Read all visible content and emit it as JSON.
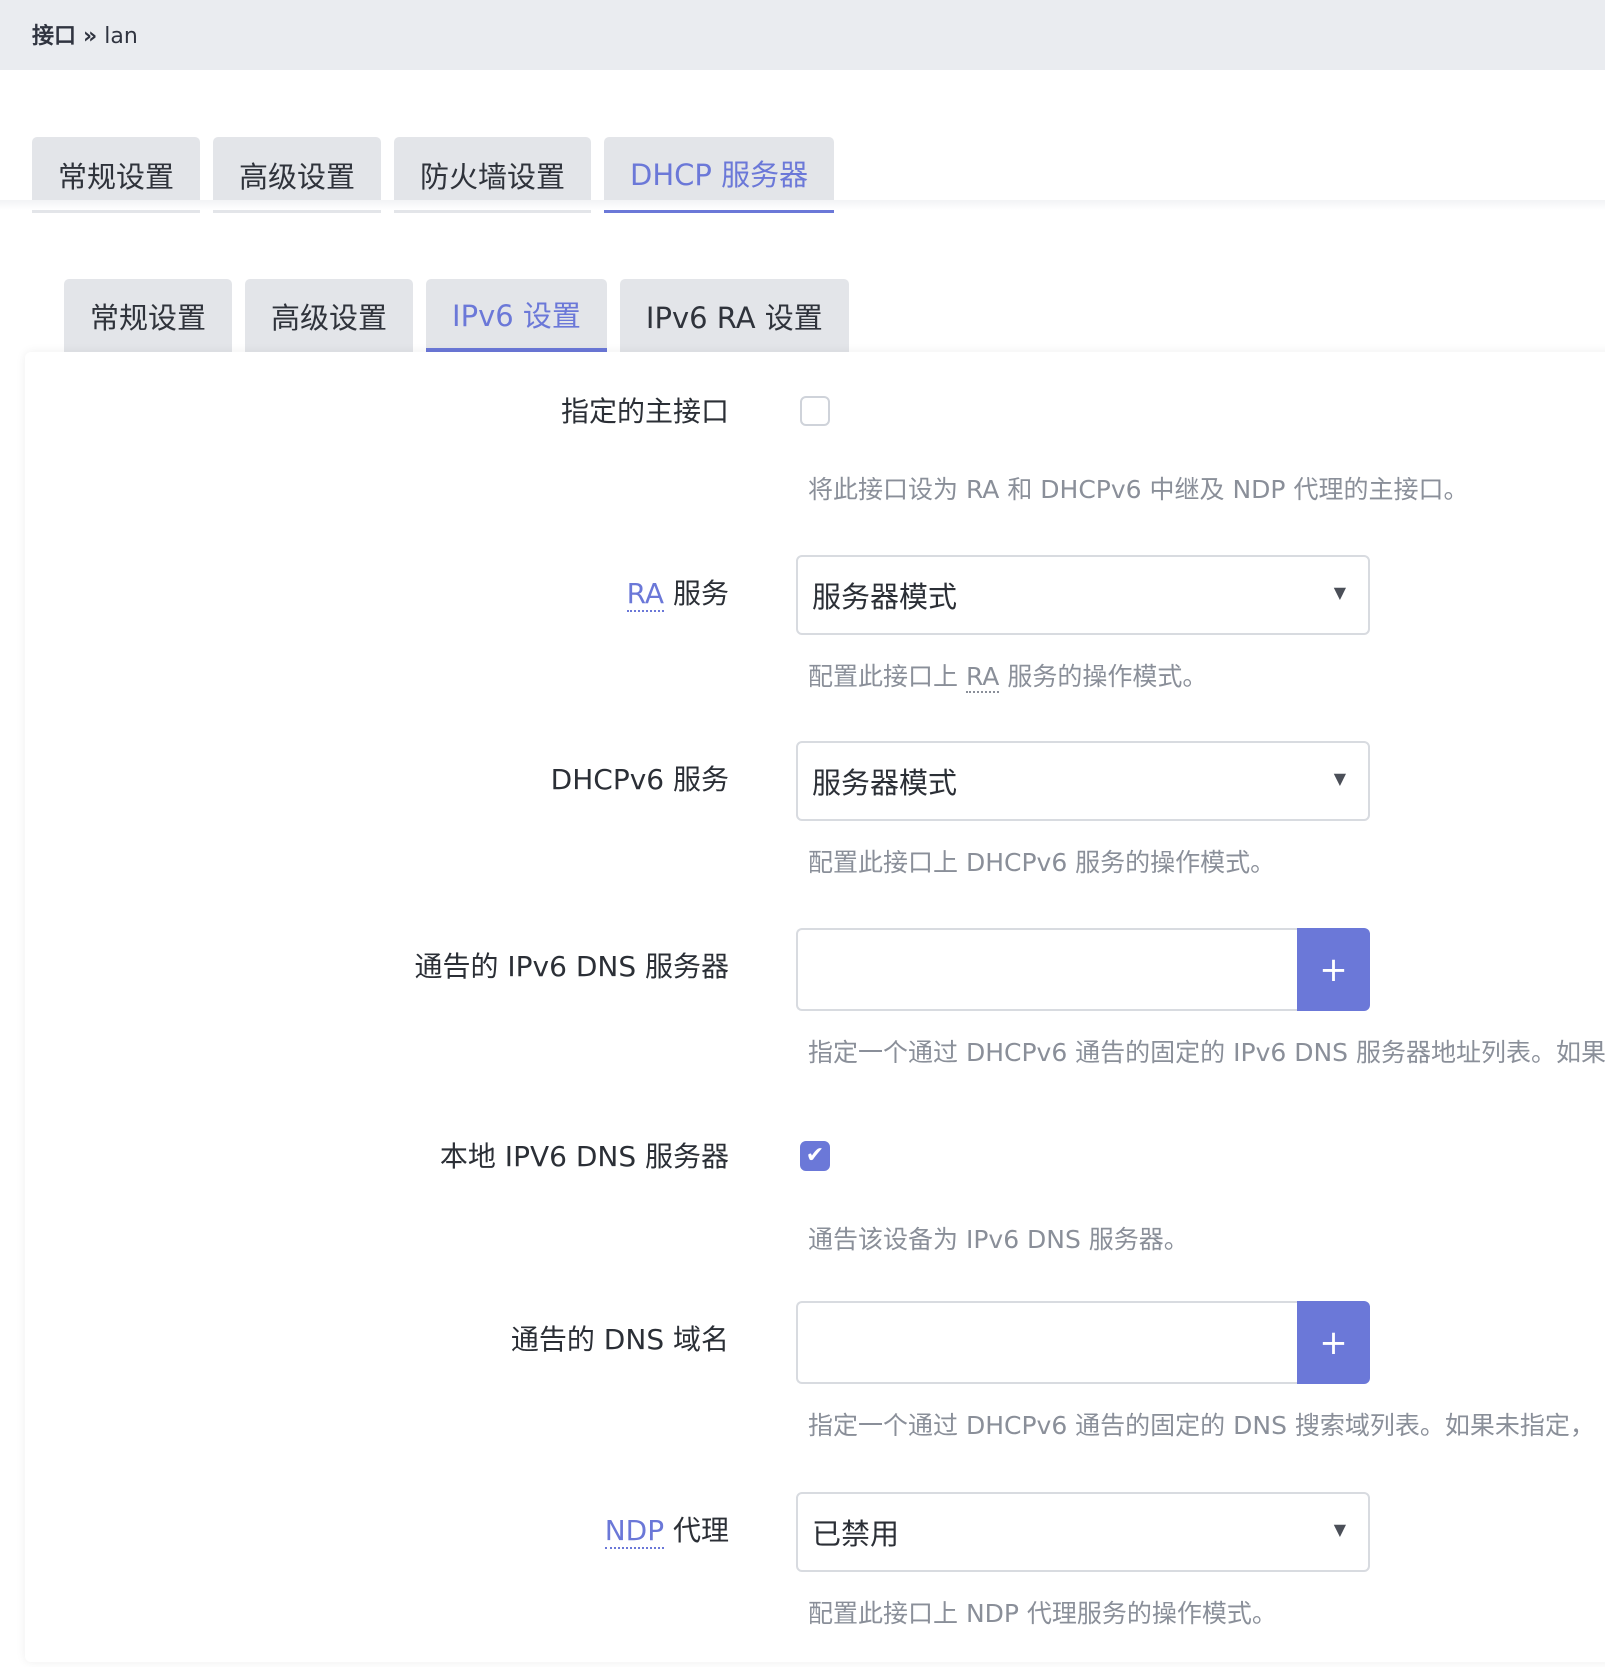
{
  "breadcrumb": {
    "section": "接口",
    "sep": "»",
    "page": "lan"
  },
  "top_tabs": [
    "常规设置",
    "高级设置",
    "防火墙设置",
    "DHCP 服务器"
  ],
  "sub_tabs": [
    "常规设置",
    "高级设置",
    "IPv6 设置",
    "IPv6 RA 设置"
  ],
  "accent_color": "#6b78d8",
  "fields": {
    "master": {
      "label": "指定的主接口",
      "checked": false,
      "desc": "将此接口设为 RA 和 DHCPv6 中继及 NDP 代理的主接口。"
    },
    "ra": {
      "label_abbr": "RA",
      "label_rest": " 服务",
      "value": "服务器模式",
      "desc_pre": "配置此接口上 ",
      "desc_abbr": "RA",
      "desc_post": " 服务的操作模式。"
    },
    "dhcpv6": {
      "label": "DHCPv6 服务",
      "value": "服务器模式",
      "desc": "配置此接口上 DHCPv6 服务的操作模式。"
    },
    "dns_servers": {
      "label": "通告的 IPv6 DNS 服务器",
      "add": "+",
      "desc": "指定一个通过 DHCPv6 通告的固定的 IPv6 DNS 服务器地址列表。如果"
    },
    "local_dns": {
      "label": "本地 IPV6 DNS 服务器",
      "checked": true,
      "check_glyph": "✔",
      "desc": "通告该设备为 IPv6 DNS 服务器。"
    },
    "dns_domains": {
      "label": "通告的 DNS 域名",
      "add": "+",
      "desc": "指定一个通过 DHCPv6 通告的固定的 DNS 搜索域列表。如果未指定，"
    },
    "ndp": {
      "label_abbr": "NDP",
      "label_rest": " 代理",
      "value": "已禁用",
      "desc": "配置此接口上 NDP 代理服务的操作模式。"
    }
  },
  "caret_glyph": "▼"
}
